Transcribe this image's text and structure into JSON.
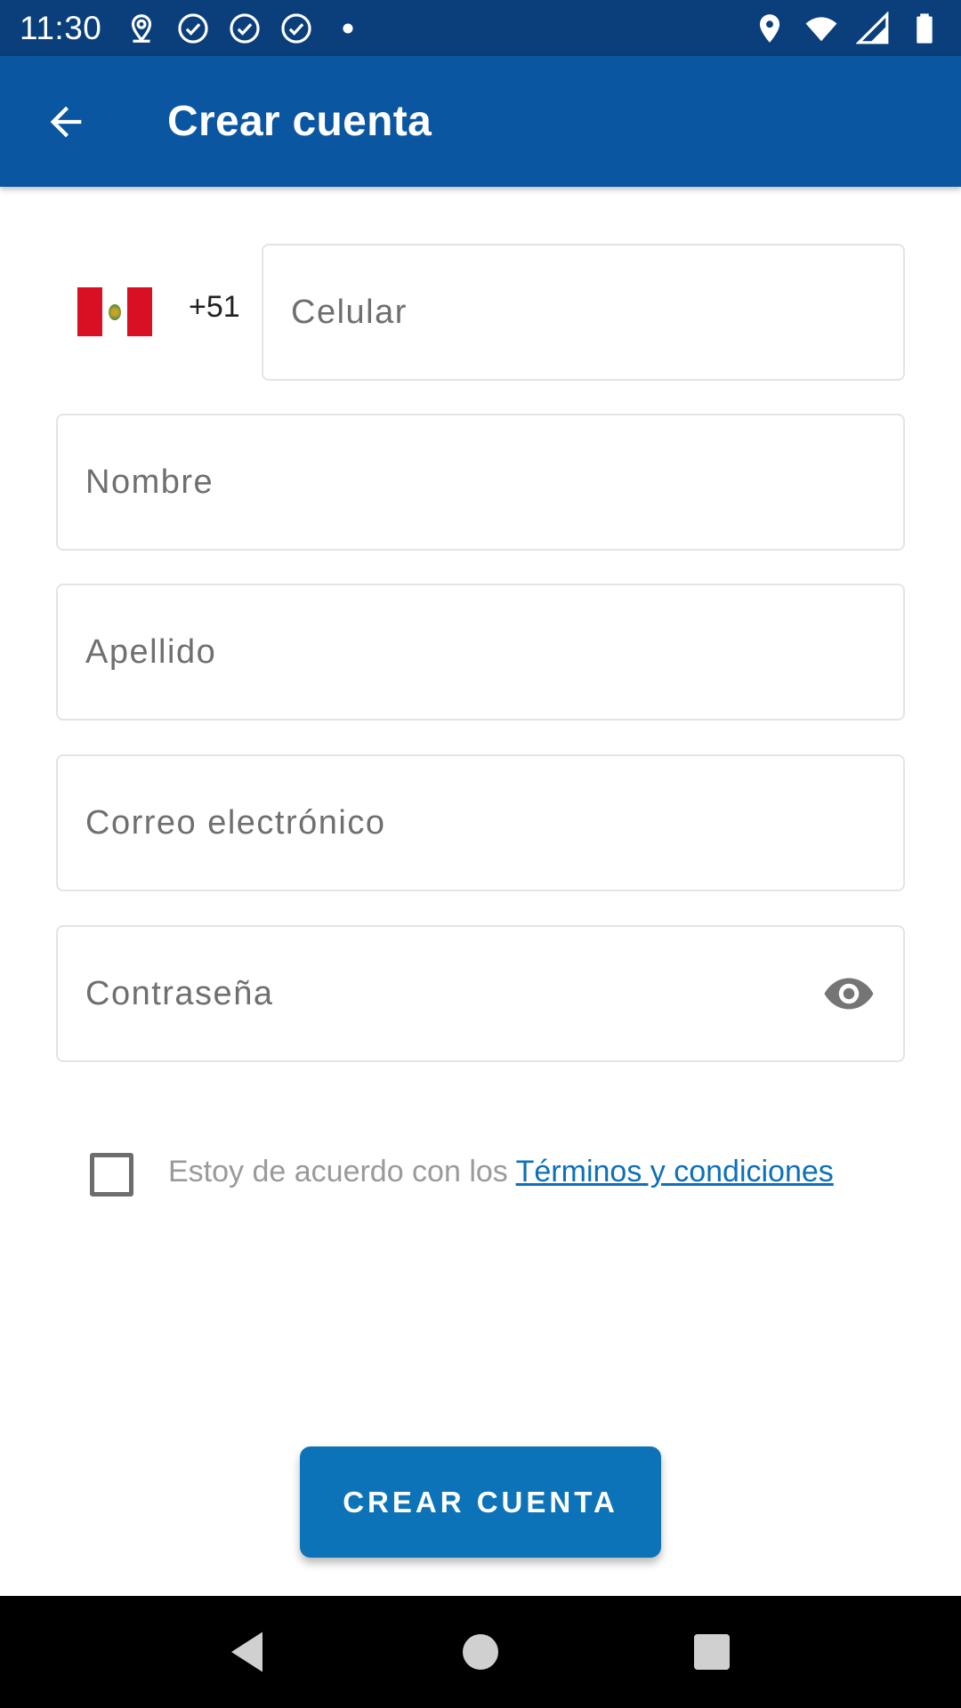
{
  "status_bar": {
    "time": "11:30",
    "left_icons": [
      "location-pin-icon",
      "check-circle-icon",
      "check-circle-icon",
      "check-circle-icon",
      "dot-icon"
    ],
    "right_icons": [
      "location-icon",
      "wifi-icon",
      "signal-icon",
      "battery-icon"
    ]
  },
  "app_bar": {
    "title": "Crear cuenta",
    "back_icon": "arrow-back-icon"
  },
  "phone": {
    "country_flag": "peru-flag-icon",
    "dial_code": "+51",
    "placeholder": "Celular"
  },
  "fields": {
    "nombre_placeholder": "Nombre",
    "apellido_placeholder": "Apellido",
    "correo_placeholder": "Correo electrónico",
    "password_placeholder": "Contraseña",
    "password_toggle_icon": "eye-icon"
  },
  "terms": {
    "checked": false,
    "text": "Estoy de acuerdo con los ",
    "link_text": "Términos y condiciones"
  },
  "create_button": {
    "label": "CREAR CUENTA"
  },
  "colors": {
    "status_bar": "#0a3f7c",
    "app_bar": "#0a56a0",
    "button": "#0c73b8",
    "link": "#0d70b8"
  }
}
